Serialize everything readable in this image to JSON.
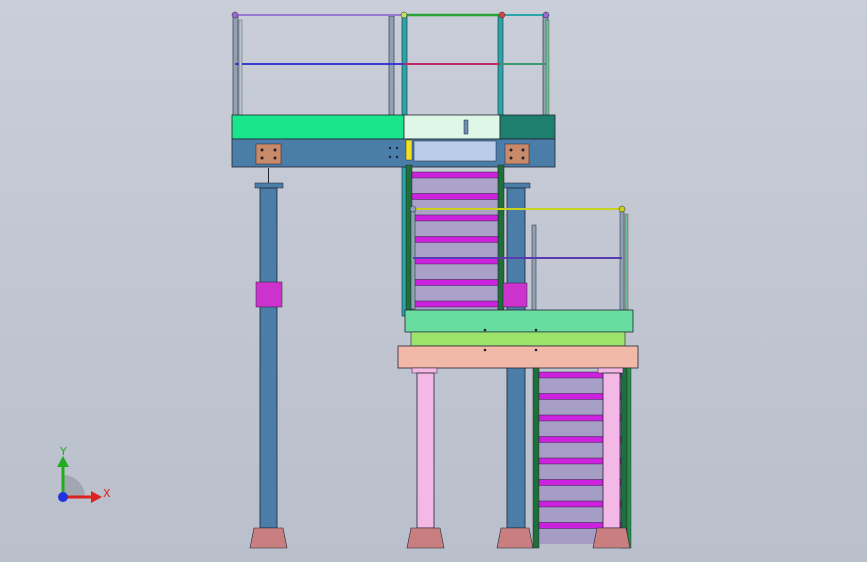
{
  "viewport": {
    "background_top": "#c9ced8",
    "background_bottom": "#b9bfcb"
  },
  "triad": {
    "y_label": "Y",
    "x_label": "X",
    "y_color": "#22aa22",
    "x_color": "#dd2222",
    "z_color": "#2233dd"
  },
  "colors": {
    "upper_deck": "#19e68a",
    "upper_deck_right": "#1f7f6f",
    "upper_beam": "#4a7ea8",
    "lower_deck": "#69dca0",
    "lower_beam": "#f2b8a8",
    "lower_band": "#9be36a",
    "column_blue": "#4a7ea8",
    "column_pink": "#f4b8e6",
    "stair_tread": "#cc22dd",
    "handrail": "#8a95a8",
    "base_plate": "#c97f7f",
    "stringer": "#1f6f3a"
  }
}
